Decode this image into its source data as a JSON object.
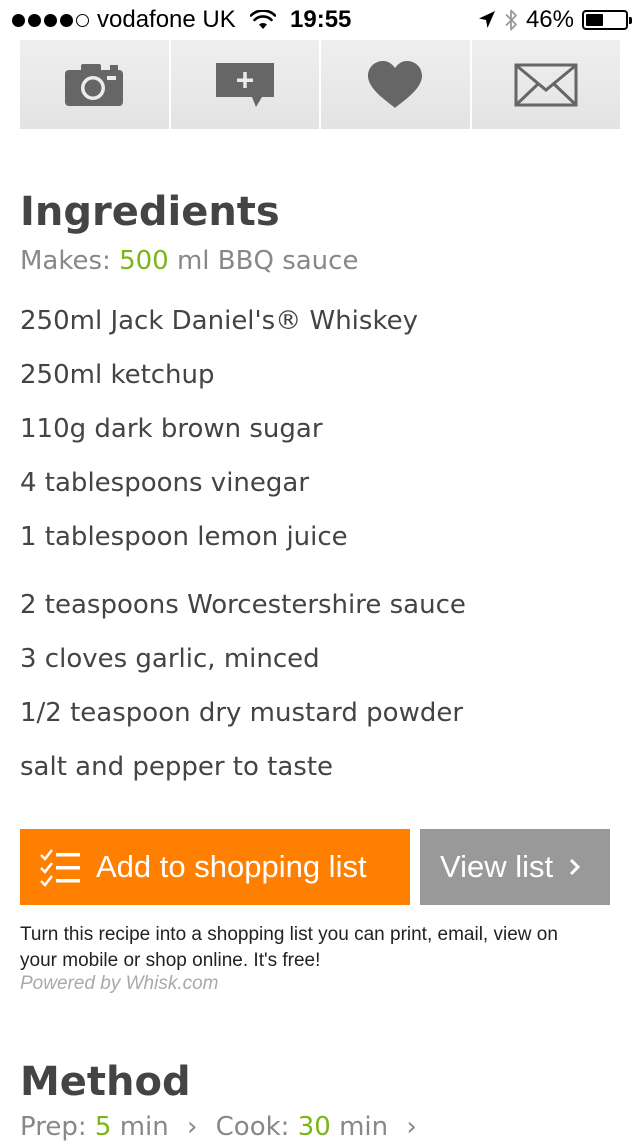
{
  "status_bar": {
    "carrier": "vodafone UK",
    "time": "19:55",
    "battery": "46%",
    "battery_level": 0.46,
    "signal_bars": 4,
    "signal_max": 5
  },
  "toolbar": {
    "items": [
      {
        "icon": "camera-icon"
      },
      {
        "icon": "add-comment-icon"
      },
      {
        "icon": "heart-icon"
      },
      {
        "icon": "mail-icon"
      }
    ]
  },
  "ingredients": {
    "title": "Ingredients",
    "makes_label": "Makes:",
    "makes_value": "500",
    "makes_unit": "ml BBQ sauce",
    "items": [
      "250ml Jack Daniel's® Whiskey",
      "250ml ketchup",
      "110g dark brown sugar",
      "4 tablespoons vinegar",
      "1 tablespoon lemon juice",
      "2 teaspoons Worcestershire sauce",
      "3 cloves garlic, minced",
      "1/2 teaspoon dry mustard powder",
      "salt and pepper to taste"
    ]
  },
  "shopping": {
    "add_label": "Add to shopping list",
    "view_label": "View list",
    "note": "Turn this recipe into a shopping list you can print, email, view on your mobile or shop online. It's free!",
    "powered": "Powered by Whisk.com"
  },
  "method": {
    "title": "Method",
    "prep_label": "Prep:",
    "prep_value": "5",
    "prep_unit": "min",
    "cook_label": "Cook:",
    "cook_value": "30",
    "cook_unit": "min"
  },
  "colors": {
    "accent_green": "#7cb518",
    "add_button": "#ff8000",
    "view_button": "#999999"
  }
}
